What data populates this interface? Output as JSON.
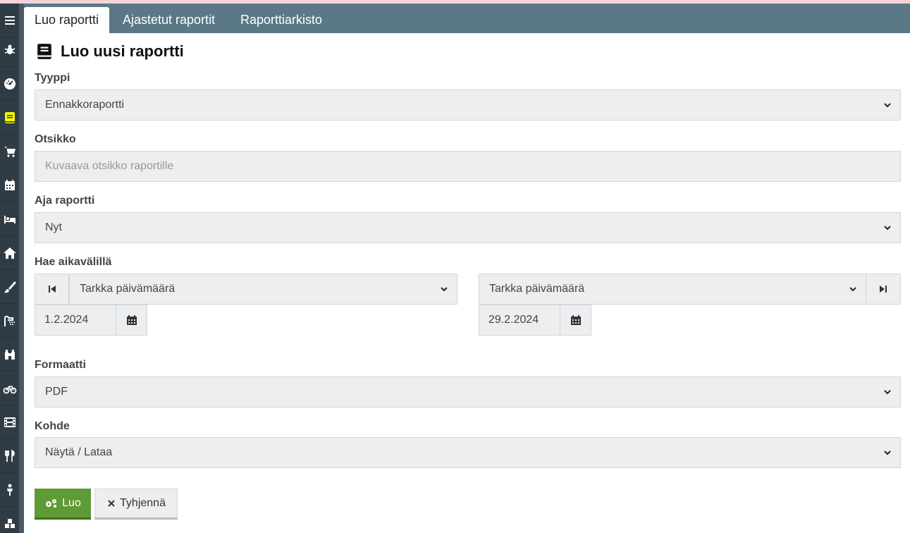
{
  "tabs": [
    {
      "label": "Luo raportti",
      "active": true
    },
    {
      "label": "Ajastetut raportit",
      "active": false
    },
    {
      "label": "Raporttiarkisto",
      "active": false
    }
  ],
  "sidebar": {
    "items": [
      {
        "icon": "menu-icon"
      },
      {
        "icon": "bug-icon"
      },
      {
        "icon": "dashboard-icon"
      },
      {
        "icon": "book-icon",
        "active": true
      },
      {
        "icon": "cart-icon"
      },
      {
        "icon": "calendar-icon"
      },
      {
        "icon": "bed-icon"
      },
      {
        "icon": "home-icon"
      },
      {
        "icon": "brush-icon"
      },
      {
        "icon": "shower-icon"
      },
      {
        "icon": "binoculars-icon"
      },
      {
        "icon": "bicycle-icon"
      },
      {
        "icon": "film-icon"
      },
      {
        "icon": "utensils-icon"
      },
      {
        "icon": "child-icon"
      },
      {
        "icon": "cubes-icon"
      }
    ],
    "active_color": "#f5f500"
  },
  "page_title": "Luo uusi raportti",
  "form": {
    "type_label": "Tyyppi",
    "type_value": "Ennakkoraportti",
    "title_label": "Otsikko",
    "title_placeholder": "Kuvaava otsikko raportille",
    "run_label": "Aja raportti",
    "run_value": "Nyt",
    "range_label": "Hae aikavälillä",
    "range_start_mode": "Tarkka päivämäärä",
    "range_end_mode": "Tarkka päivämäärä",
    "range_start_date": "1.2.2024",
    "range_end_date": "29.2.2024",
    "format_label": "Formaatti",
    "format_value": "PDF",
    "target_label": "Kohde",
    "target_value": "Näytä / Lataa"
  },
  "buttons": {
    "create_label": "Luo",
    "clear_label": "Tyhjennä"
  },
  "colors": {
    "tabbar": "#5a7886",
    "sidebar": "#2f3c45",
    "create_button": "#5e9a35",
    "field_bg": "#eceef0"
  }
}
